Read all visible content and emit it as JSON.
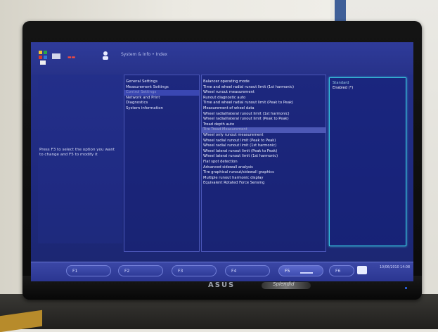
{
  "monitor": {
    "brand": "ASUS",
    "badge_label": "Splendid"
  },
  "screen": {
    "title": "System & Info  • Index",
    "help_text": "Press F3 to select the option you want to change and F5 to modify it",
    "menu_items": [
      {
        "label": "General Settings",
        "active": false
      },
      {
        "label": "Measurement Settings",
        "active": false
      },
      {
        "label": "Control Settings",
        "active": true
      },
      {
        "label": "Network and Print",
        "active": false
      },
      {
        "label": "Diagnostics",
        "active": false
      },
      {
        "label": "System information",
        "active": false
      }
    ],
    "list_items": [
      {
        "label": "Balancer operating mode",
        "selected": false
      },
      {
        "label": "Time and wheel radial runout limit (1st harmonic)",
        "selected": false
      },
      {
        "label": "Wheel runout measurement",
        "selected": false
      },
      {
        "label": "Runout diagnostic auto",
        "selected": false
      },
      {
        "label": "Time and wheel radial runout limit (Peak to Peak)",
        "selected": false
      },
      {
        "label": "Measurement of wheel data",
        "selected": false
      },
      {
        "label": "Wheel radial/lateral runout limit (1st harmonic)",
        "selected": false
      },
      {
        "label": "Wheel radial/lateral runout limit (Peak to Peak)",
        "selected": false
      },
      {
        "label": "Tread depth auto",
        "selected": false
      },
      {
        "label": "Tire Tread Measurement",
        "selected": true
      },
      {
        "label": "Wheel only runout measurement",
        "selected": false
      },
      {
        "label": "Wheel radial runout limit (Peak to Peak)",
        "selected": false
      },
      {
        "label": "Wheel radial runout limit (1st harmonic)",
        "selected": false
      },
      {
        "label": "Wheel lateral runout limit (Peak to Peak)",
        "selected": false
      },
      {
        "label": "Wheel lateral runout limit (1st harmonic)",
        "selected": false
      },
      {
        "label": "Flat spot detection",
        "selected": false
      },
      {
        "label": "Advanced sidewall analysis",
        "selected": false
      },
      {
        "label": "Tire graphical runout/sidewall graphics",
        "selected": false
      },
      {
        "label": "Multiple runout harmonic display",
        "selected": false
      },
      {
        "label": "Equivalent Rotated Force Sensing",
        "selected": false
      }
    ],
    "options": {
      "label": "Standard",
      "value": "Enabled (*)"
    },
    "fkeys": [
      {
        "label": "F1",
        "active": false
      },
      {
        "label": "F2",
        "active": false
      },
      {
        "label": "F3",
        "active": false
      },
      {
        "label": "F4",
        "active": false
      },
      {
        "label": "F5",
        "active": true
      },
      {
        "label": "F6",
        "active": false
      }
    ],
    "status_text": "10/06/2010 14:08"
  },
  "colors": {
    "screen_bg": "#26328c",
    "accent_cyan": "#35c4dc",
    "logo_red": "#ff4c3c"
  }
}
